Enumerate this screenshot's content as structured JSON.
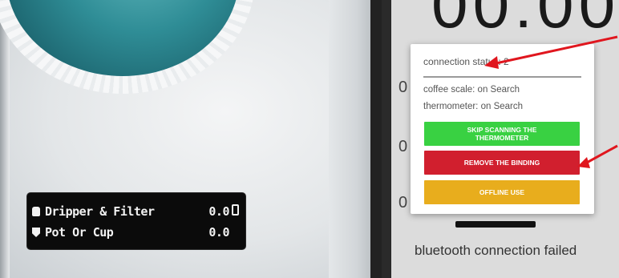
{
  "scale_display": {
    "row1": {
      "icon": "bottle-icon",
      "label": "Dripper & Filter",
      "value": "0.0"
    },
    "row2": {
      "icon": "cup-icon",
      "label": "Pot Or Cup",
      "value": "0.0"
    },
    "battery_icon": "battery-icon"
  },
  "phone": {
    "timer": "00:00",
    "background_values": [
      "0",
      "0",
      "0"
    ],
    "status_message": "bluetooth connection failed"
  },
  "dialog": {
    "connection_status": "connection status: 2",
    "coffee_scale": "coffee scale: on Search",
    "thermometer": "thermometer: on Search",
    "skip_button": "SKIP SCANNING THE THERMOMETER",
    "remove_button": "REMOVE THE BINDING",
    "offline_button": "OFFLINE USE"
  },
  "colors": {
    "skip": "#39d142",
    "remove": "#d11f2e",
    "offline": "#e8ad1d",
    "annotation_arrow": "#e0161e"
  }
}
